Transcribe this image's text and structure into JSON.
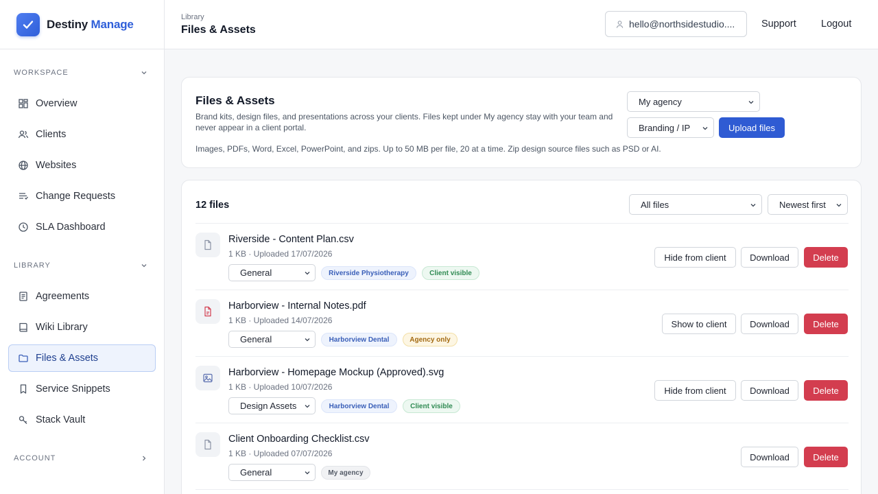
{
  "brand": {
    "name_part1": "Destiny",
    "name_part2": "Manage"
  },
  "sidebar": {
    "workspace_label": "WORKSPACE",
    "library_label": "LIBRARY",
    "account_label": "ACCOUNT",
    "workspace_items": [
      {
        "label": "Overview",
        "icon": "grid-icon"
      },
      {
        "label": "Clients",
        "icon": "users-icon"
      },
      {
        "label": "Websites",
        "icon": "globe-icon"
      },
      {
        "label": "Change Requests",
        "icon": "list-icon"
      },
      {
        "label": "SLA Dashboard",
        "icon": "clock-icon"
      }
    ],
    "library_items": [
      {
        "label": "Agreements",
        "icon": "document-icon"
      },
      {
        "label": "Wiki Library",
        "icon": "book-icon"
      },
      {
        "label": "Files & Assets",
        "icon": "folder-icon",
        "active": true
      },
      {
        "label": "Service Snippets",
        "icon": "bookmark-icon"
      },
      {
        "label": "Stack Vault",
        "icon": "key-icon"
      }
    ]
  },
  "header": {
    "breadcrumb": "Library",
    "title": "Files & Assets",
    "email": "hello@northsidestudio....",
    "support": "Support",
    "logout": "Logout"
  },
  "upload_card": {
    "title": "Files & Assets",
    "description": "Brand kits, design files, and presentations across your clients. Files kept under My agency stay with your team and never appear in a client portal.",
    "hint": "Images, PDFs, Word, Excel, PowerPoint, and zips. Up to 50 MB per file, 20 at a time. Zip design source files such as PSD or AI.",
    "owner_select": "My agency",
    "category_select": "Branding / IP",
    "upload_button": "Upload files"
  },
  "files_card": {
    "count": "12 files",
    "filter_select": "All files",
    "sort_select": "Newest first",
    "download_label": "Download",
    "delete_label": "Delete",
    "files": [
      {
        "name": "Riverside - Content Plan.csv",
        "meta": "1 KB · Uploaded 17/07/2026",
        "category": "General",
        "client": "Riverside Physiotherapy",
        "visibility": "Client visible",
        "toggle": "Hide from client",
        "icon": "file-icon"
      },
      {
        "name": "Harborview - Internal Notes.pdf",
        "meta": "1 KB · Uploaded 14/07/2026",
        "category": "General",
        "client": "Harborview Dental",
        "visibility": "Agency only",
        "toggle": "Show to client",
        "icon": "pdf-icon"
      },
      {
        "name": "Harborview - Homepage Mockup (Approved).svg",
        "meta": "1 KB · Uploaded 10/07/2026",
        "category": "Design Assets",
        "client": "Harborview Dental",
        "visibility": "Client visible",
        "toggle": "Hide from client",
        "icon": "image-icon"
      },
      {
        "name": "Client Onboarding Checklist.csv",
        "meta": "1 KB · Uploaded 07/07/2026",
        "category": "General",
        "client": "My agency",
        "icon": "file-icon"
      }
    ]
  },
  "colors": {
    "accent": "#2f5bd3",
    "danger": "#d33d4f",
    "active_nav_bg": "#eef3fd"
  }
}
